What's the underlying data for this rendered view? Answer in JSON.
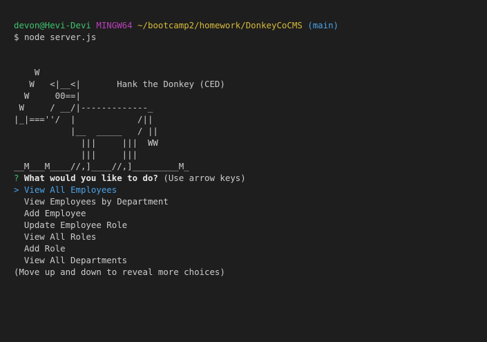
{
  "prompt": {
    "user_host": "devon@Hevi-Devi",
    "shell": "MINGW64",
    "path": "~/bootcamp2/homework/DonkeyCoCMS",
    "branch": "(main)",
    "symbol": "$",
    "command": "node server.js"
  },
  "ascii_art": [
    "    W",
    "   W   <|__<|       Hank the Donkey (CED)",
    "  W     00==|",
    " W     / __/|-------------_",
    "|_|===''/  |            /||",
    "           |__  _____   / ||",
    "             |||     |||  WW",
    "             |||     |||",
    "__M___M____//,]____//,]_________M_"
  ],
  "question": {
    "mark": "?",
    "text": "What would you like to do?",
    "hint": "(Use arrow keys)"
  },
  "menu": {
    "pointer": ">",
    "items": [
      "View All Employees",
      "View Employees by Department",
      "Add Employee",
      "Update Employee Role",
      "View All Roles",
      "Add Role",
      "View All Departments"
    ],
    "selected_index": 0
  },
  "footer_hint": "(Move up and down to reveal more choices)",
  "colors": {
    "background": "#1e1e1e",
    "user_host": "#3fc26e",
    "shell": "#bc3fbc",
    "path": "#d7ba3b",
    "branch": "#4aa3e8",
    "selected": "#4aa3e8",
    "question_mark": "#3fc26e"
  }
}
